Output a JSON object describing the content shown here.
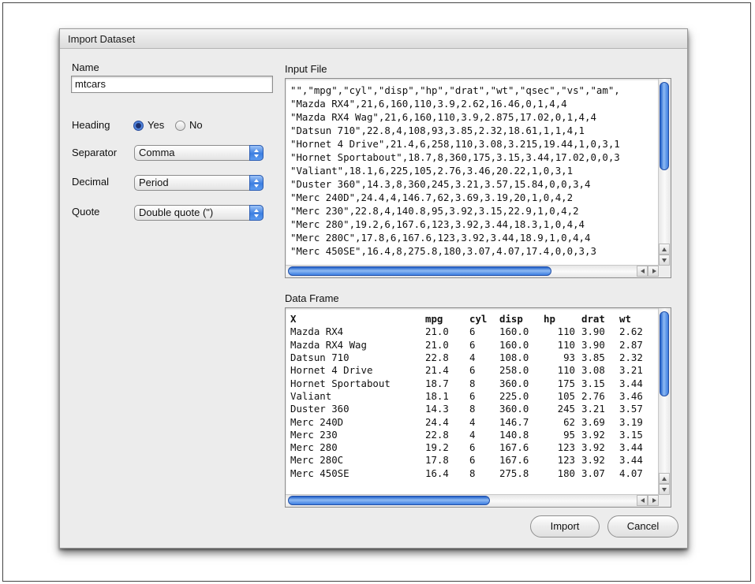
{
  "dialog": {
    "title": "Import Dataset"
  },
  "form": {
    "name_label": "Name",
    "name_value": "mtcars",
    "heading_label": "Heading",
    "heading_yes": "Yes",
    "heading_no": "No",
    "heading_selected": "Yes",
    "separator_label": "Separator",
    "separator_value": "Comma",
    "decimal_label": "Decimal",
    "decimal_value": "Period",
    "quote_label": "Quote",
    "quote_value": "Double quote (\")"
  },
  "input_file": {
    "label": "Input File",
    "lines": [
      "\"\",\"mpg\",\"cyl\",\"disp\",\"hp\",\"drat\",\"wt\",\"qsec\",\"vs\",\"am\",",
      "\"Mazda RX4\",21,6,160,110,3.9,2.62,16.46,0,1,4,4",
      "\"Mazda RX4 Wag\",21,6,160,110,3.9,2.875,17.02,0,1,4,4",
      "\"Datsun 710\",22.8,4,108,93,3.85,2.32,18.61,1,1,4,1",
      "\"Hornet 4 Drive\",21.4,6,258,110,3.08,3.215,19.44,1,0,3,1",
      "\"Hornet Sportabout\",18.7,8,360,175,3.15,3.44,17.02,0,0,3",
      "\"Valiant\",18.1,6,225,105,2.76,3.46,20.22,1,0,3,1",
      "\"Duster 360\",14.3,8,360,245,3.21,3.57,15.84,0,0,3,4",
      "\"Merc 240D\",24.4,4,146.7,62,3.69,3.19,20,1,0,4,2",
      "\"Merc 230\",22.8,4,140.8,95,3.92,3.15,22.9,1,0,4,2",
      "\"Merc 280\",19.2,6,167.6,123,3.92,3.44,18.3,1,0,4,4",
      "\"Merc 280C\",17.8,6,167.6,123,3.92,3.44,18.9,1,0,4,4",
      "\"Merc 450SE\",16.4,8,275.8,180,3.07,4.07,17.4,0,0,3,3"
    ]
  },
  "data_frame": {
    "label": "Data Frame",
    "columns": [
      "X",
      "mpg",
      "cyl",
      "disp",
      "hp",
      "drat",
      "wt"
    ],
    "rows": [
      [
        "Mazda RX4",
        "21.0",
        "6",
        "160.0",
        "110",
        "3.90",
        "2.62"
      ],
      [
        "Mazda RX4 Wag",
        "21.0",
        "6",
        "160.0",
        "110",
        "3.90",
        "2.87"
      ],
      [
        "Datsun 710",
        "22.8",
        "4",
        "108.0",
        "93",
        "3.85",
        "2.32"
      ],
      [
        "Hornet 4 Drive",
        "21.4",
        "6",
        "258.0",
        "110",
        "3.08",
        "3.21"
      ],
      [
        "Hornet Sportabout",
        "18.7",
        "8",
        "360.0",
        "175",
        "3.15",
        "3.44"
      ],
      [
        "Valiant",
        "18.1",
        "6",
        "225.0",
        "105",
        "2.76",
        "3.46"
      ],
      [
        "Duster 360",
        "14.3",
        "8",
        "360.0",
        "245",
        "3.21",
        "3.57"
      ],
      [
        "Merc 240D",
        "24.4",
        "4",
        "146.7",
        "62",
        "3.69",
        "3.19"
      ],
      [
        "Merc 230",
        "22.8",
        "4",
        "140.8",
        "95",
        "3.92",
        "3.15"
      ],
      [
        "Merc 280",
        "19.2",
        "6",
        "167.6",
        "123",
        "3.92",
        "3.44"
      ],
      [
        "Merc 280C",
        "17.8",
        "6",
        "167.6",
        "123",
        "3.92",
        "3.44"
      ],
      [
        "Merc 450SE",
        "16.4",
        "8",
        "275.8",
        "180",
        "3.07",
        "4.07"
      ]
    ]
  },
  "buttons": {
    "import": "Import",
    "cancel": "Cancel"
  },
  "icons": {
    "select_arrow": "up-down-chevron-icon",
    "radio_on": "radio-selected-icon",
    "radio_off": "radio-unselected-icon"
  }
}
